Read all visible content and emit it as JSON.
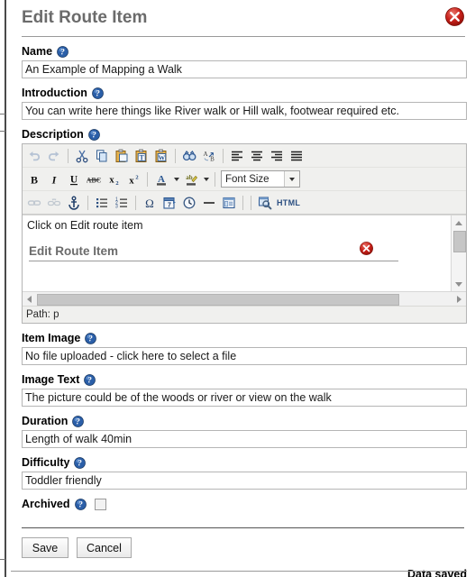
{
  "dialog": {
    "title": "Edit Route Item",
    "close_icon": "close-circle-icon"
  },
  "fields": {
    "name": {
      "label": "Name",
      "value": "An Example of Mapping a Walk",
      "help_icon": "help-icon"
    },
    "introduction": {
      "label": "Introduction",
      "value": "You can write here things like River walk or Hill walk, footwear required etc.",
      "help_icon": "help-icon"
    },
    "description": {
      "label": "Description",
      "help_icon": "help-icon"
    },
    "item_image": {
      "label": "Item Image",
      "value": "No file uploaded - click here to select a file",
      "help_icon": "help-icon"
    },
    "image_text": {
      "label": "Image Text",
      "value": "The picture could be of the woods or river or view on the walk",
      "help_icon": "help-icon"
    },
    "duration": {
      "label": "Duration",
      "value": "Length of walk 40min",
      "help_icon": "help-icon"
    },
    "difficulty": {
      "label": "Difficulty",
      "value": "Toddler friendly",
      "help_icon": "help-icon"
    },
    "archived": {
      "label": "Archived",
      "checked": false,
      "help_icon": "help-icon"
    }
  },
  "editor": {
    "font_size_label": "Font Size",
    "html_label": "HTML",
    "body_text": "Click on Edit route item",
    "embedded": {
      "title": "Edit Route Item",
      "close_icon": "close-circle-icon"
    },
    "status_prefix": "Path:",
    "status_value": "p",
    "toolbar_rows": [
      [
        {
          "name": "undo-icon",
          "label": "Undo",
          "disabled": true
        },
        {
          "name": "redo-icon",
          "label": "Redo",
          "disabled": true
        },
        {
          "name": "separator"
        },
        {
          "name": "cut-icon",
          "label": "Cut"
        },
        {
          "name": "copy-icon",
          "label": "Copy"
        },
        {
          "name": "paste-icon",
          "label": "Paste"
        },
        {
          "name": "paste-as-text-icon",
          "label": "Paste as Plain Text"
        },
        {
          "name": "paste-from-word-icon",
          "label": "Paste from Word"
        },
        {
          "name": "separator"
        },
        {
          "name": "find-icon",
          "label": "Find"
        },
        {
          "name": "find-replace-icon",
          "label": "Find/Replace"
        },
        {
          "name": "separator"
        },
        {
          "name": "align-left-icon",
          "label": "Align Left"
        },
        {
          "name": "align-center-icon",
          "label": "Align Center"
        },
        {
          "name": "align-right-icon",
          "label": "Align Right"
        },
        {
          "name": "align-justify-icon",
          "label": "Justify"
        }
      ],
      [
        {
          "name": "bold-icon",
          "label": "Bold"
        },
        {
          "name": "italic-icon",
          "label": "Italic"
        },
        {
          "name": "underline-icon",
          "label": "Underline"
        },
        {
          "name": "strikethrough-icon",
          "label": "Strikethrough"
        },
        {
          "name": "subscript-icon",
          "label": "Subscript"
        },
        {
          "name": "superscript-icon",
          "label": "Superscript"
        },
        {
          "name": "separator"
        },
        {
          "name": "text-color-icon",
          "label": "Text Colour"
        },
        {
          "name": "text-color-arrow-icon",
          "label": "Text Colour Options"
        },
        {
          "name": "background-color-icon",
          "label": "Background Colour"
        },
        {
          "name": "background-color-arrow-icon",
          "label": "Background Colour Options"
        },
        {
          "name": "separator"
        },
        {
          "name": "font-size-select",
          "label": "Font Size"
        }
      ],
      [
        {
          "name": "link-icon",
          "label": "Insert Link",
          "disabled": true
        },
        {
          "name": "unlink-icon",
          "label": "Unlink",
          "disabled": true
        },
        {
          "name": "anchor-icon",
          "label": "Anchor"
        },
        {
          "name": "separator"
        },
        {
          "name": "bullet-list-icon",
          "label": "Unordered List"
        },
        {
          "name": "numbered-list-icon",
          "label": "Ordered List"
        },
        {
          "name": "separator"
        },
        {
          "name": "special-character-icon",
          "label": "Insert Special Character"
        },
        {
          "name": "insert-date-icon",
          "label": "Insert Date"
        },
        {
          "name": "insert-time-icon",
          "label": "Insert Time"
        },
        {
          "name": "horizontal-rule-icon",
          "label": "Horizontal Rule"
        },
        {
          "name": "template-icon",
          "label": "Insert Template"
        },
        {
          "name": "separator"
        },
        {
          "name": "separator"
        },
        {
          "name": "preview-icon",
          "label": "Preview"
        },
        {
          "name": "html-source-button",
          "label": "HTML"
        }
      ]
    ]
  },
  "footer": {
    "save_label": "Save",
    "cancel_label": "Cancel",
    "status_message": "Data saved"
  },
  "colors": {
    "title_grey": "#6b6b6b",
    "close_red": "#c0190f",
    "help_blue": "#2b5fa8",
    "icon_blue": "#2b4f81"
  }
}
